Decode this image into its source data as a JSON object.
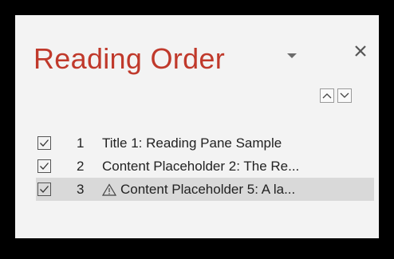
{
  "pane": {
    "title": "Reading Order",
    "dropdown_icon": "chevron-down-icon",
    "close_label": "✕",
    "move_up_icon": "move-up-icon",
    "move_down_icon": "move-down-icon"
  },
  "items": [
    {
      "number": "1",
      "label": "Title 1: Reading Pane Sample",
      "checked": true,
      "warning": false
    },
    {
      "number": "2",
      "label": "Content Placeholder 2: The Re...",
      "checked": true,
      "warning": false
    },
    {
      "number": "3",
      "label": "Content Placeholder 5: A la...",
      "checked": true,
      "warning": true,
      "selected": true
    }
  ]
}
